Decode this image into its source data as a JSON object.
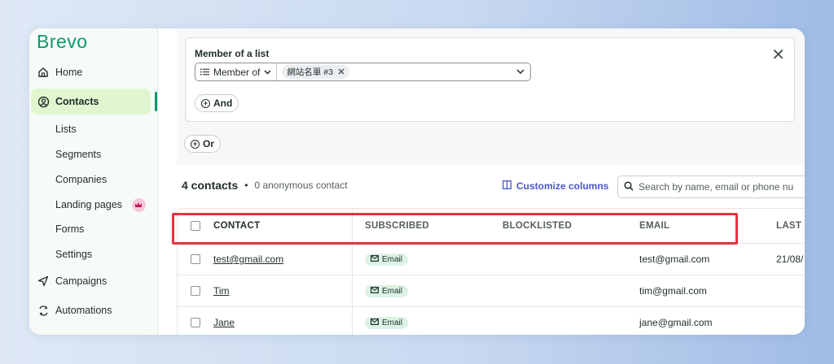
{
  "sidebar": {
    "logo": "Brevo",
    "items": [
      {
        "label": "Home",
        "icon": "home-icon"
      },
      {
        "label": "Contacts",
        "icon": "contacts-icon",
        "active": true
      },
      {
        "label": "Campaigns",
        "icon": "send-icon"
      },
      {
        "label": "Automations",
        "icon": "automation-icon"
      }
    ],
    "subitems": [
      "Lists",
      "Segments",
      "Companies",
      "Landing pages",
      "Forms",
      "Settings"
    ]
  },
  "filter": {
    "title": "Member of a list",
    "operator": "Member of",
    "chip": "網站名單 #3",
    "and_label": "And",
    "or_label": "Or"
  },
  "summary": {
    "count": "4 contacts",
    "separator": "•",
    "anonymous": "0 anonymous contact",
    "customize": "Customize columns",
    "search_placeholder": "Search by name, email or phone nu"
  },
  "table": {
    "columns": [
      "CONTACT",
      "SUBSCRIBED",
      "BLOCKLISTED",
      "EMAIL",
      "LAST C"
    ],
    "rows": [
      {
        "contact": "test@gmail.com",
        "subscribed": "Email",
        "email": "test@gmail.com",
        "last": "21/08/"
      },
      {
        "contact": "Tim",
        "subscribed": "Email",
        "email": "tim@gmail.com",
        "last": ""
      },
      {
        "contact": "Jane",
        "subscribed": "Email",
        "email": "jane@gmail.com",
        "last": ""
      }
    ]
  },
  "colors": {
    "accent": "#0b996e",
    "active_bg": "#dff6cf",
    "link": "#4b55c8",
    "highlight": "#e5323f"
  }
}
